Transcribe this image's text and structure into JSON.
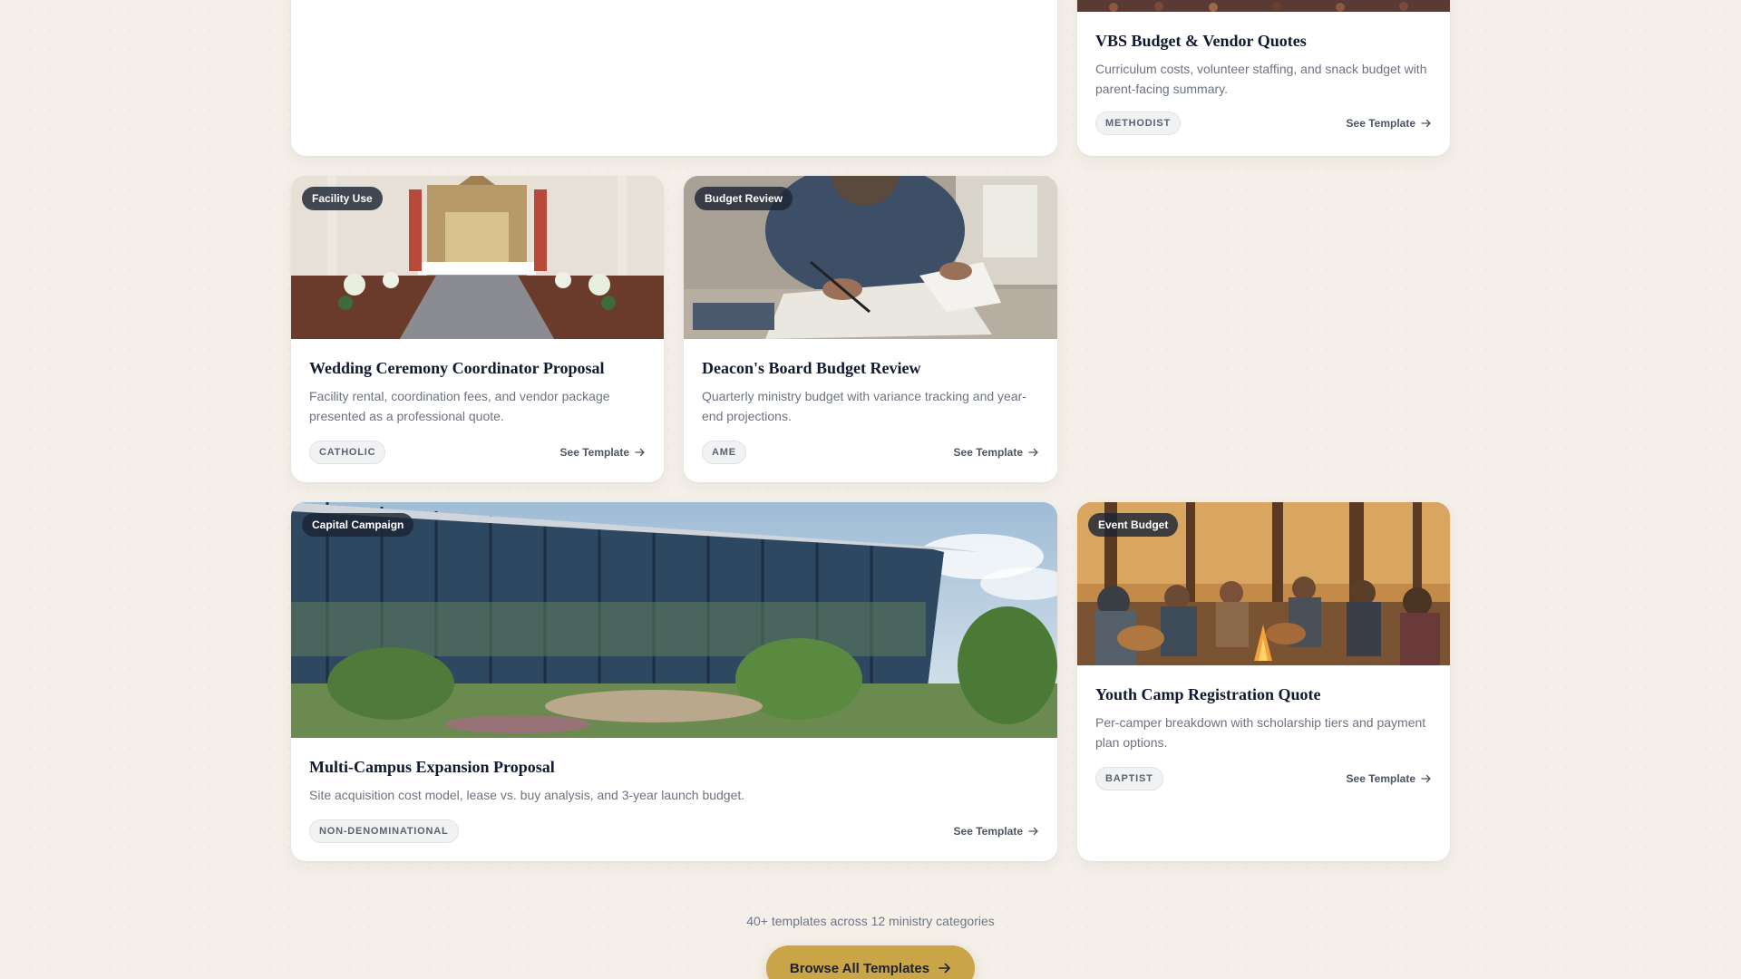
{
  "cards": [
    {
      "id": "vbs",
      "title": "VBS Budget & Vendor Quotes",
      "description": "Curriculum costs, volunteer staffing, and snack budget with parent-facing summary.",
      "tag": "METHODIST",
      "link": "See Template"
    },
    {
      "id": "wedding",
      "category": "Facility Use",
      "title": "Wedding Ceremony Coordinator Proposal",
      "description": "Facility rental, coordination fees, and vendor package presented as a professional quote.",
      "tag": "CATHOLIC",
      "link": "See Template"
    },
    {
      "id": "deacon",
      "category": "Budget Review",
      "title": "Deacon's Board Budget Review",
      "description": "Quarterly ministry budget with variance tracking and year-end projections.",
      "tag": "AME",
      "link": "See Template"
    },
    {
      "id": "campus",
      "category": "Capital Campaign",
      "title": "Multi-Campus Expansion Proposal",
      "description": "Site acquisition cost model, lease vs. buy analysis, and 3-year launch budget.",
      "tag": "NON-DENOMINATIONAL",
      "link": "See Template"
    },
    {
      "id": "youth",
      "category": "Event Budget",
      "title": "Youth Camp Registration Quote",
      "description": "Per-camper breakdown with scholarship tiers and payment plan options.",
      "tag": "BAPTIST",
      "link": "See Template"
    }
  ],
  "footer": {
    "note": "40+ templates across 12 ministry categories",
    "button_label": "Browse All Templates"
  },
  "colors": {
    "page_background": "#f4f0e9",
    "accent_gold": "#c9a547",
    "title_navy": "#101a2e",
    "badge_dark": "#1c2434"
  }
}
